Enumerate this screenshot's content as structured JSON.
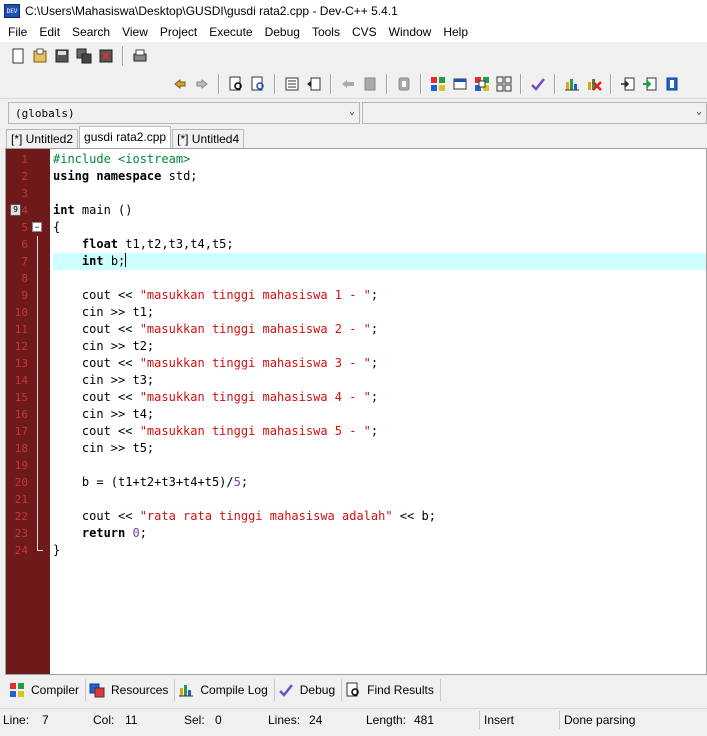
{
  "window": {
    "title": "C:\\Users\\Mahasiswa\\Desktop\\GUSDI\\gusdi rata2.cpp - Dev-C++ 5.4.1",
    "icon": "devcpp-app-icon",
    "icon_text": "DEV"
  },
  "menu": [
    "File",
    "Edit",
    "Search",
    "View",
    "Project",
    "Execute",
    "Debug",
    "Tools",
    "CVS",
    "Window",
    "Help"
  ],
  "combos": {
    "scope": "(globals)",
    "member": ""
  },
  "tabs": [
    {
      "label": "[*] Untitled2",
      "active": false
    },
    {
      "label": "gusdi rata2.cpp",
      "active": true
    },
    {
      "label": "[*] Untitled4",
      "active": false
    }
  ],
  "editor": {
    "line_numbers": [
      "1",
      "2",
      "3",
      "4",
      "5",
      "6",
      "7",
      "8",
      "9",
      "10",
      "11",
      "12",
      "13",
      "14",
      "15",
      "16",
      "17",
      "18",
      "19",
      "20",
      "21",
      "22",
      "23",
      "24"
    ],
    "fold_marker": "−",
    "bookmark_label": "9",
    "current_line": 7,
    "lines": [
      "#include <iostream>",
      "using namespace std;",
      "",
      "int main ()",
      "{",
      "    float t1,t2,t3,t4,t5;",
      "    int b;",
      "",
      "    cout << \"masukkan tinggi mahasiswa 1 - \";",
      "    cin >> t1;",
      "    cout << \"masukkan tinggi mahasiswa 2 - \";",
      "    cin >> t2;",
      "    cout << \"masukkan tinggi mahasiswa 3 - \";",
      "    cin >> t3;",
      "    cout << \"masukkan tinggi mahasiswa 4 - \";",
      "    cin >> t4;",
      "    cout << \"masukkan tinggi mahasiswa 5 - \";",
      "    cin >> t5;",
      "",
      "    b = (t1+t2+t3+t4+t5)/5;",
      "",
      "    cout << \"rata rata tinggi mahasiswa adalah\" << b;",
      "    return 0;",
      "}"
    ]
  },
  "bottom_tabs": [
    {
      "label": "Compiler",
      "icon": "compiler-grid-icon"
    },
    {
      "label": "Resources",
      "icon": "resources-icon"
    },
    {
      "label": "Compile Log",
      "icon": "compile-log-chart-icon"
    },
    {
      "label": "Debug",
      "icon": "debug-check-icon"
    },
    {
      "label": "Find Results",
      "icon": "find-results-icon"
    }
  ],
  "status": {
    "line_label": "Line:",
    "line_value": "7",
    "col_label": "Col:",
    "col_value": "11",
    "sel_label": "Sel:",
    "sel_value": "0",
    "lines_label": "Lines:",
    "lines_value": "24",
    "length_label": "Length:",
    "length_value": "481",
    "mode": "Insert",
    "message": "Done parsing"
  },
  "colors": {
    "gutter": "#6e1a1a",
    "line_number": "#c43a3a",
    "current_line": "#ccffff",
    "string": "#d01010",
    "preprocessor": "#008a3a",
    "number": "#7040a0"
  }
}
